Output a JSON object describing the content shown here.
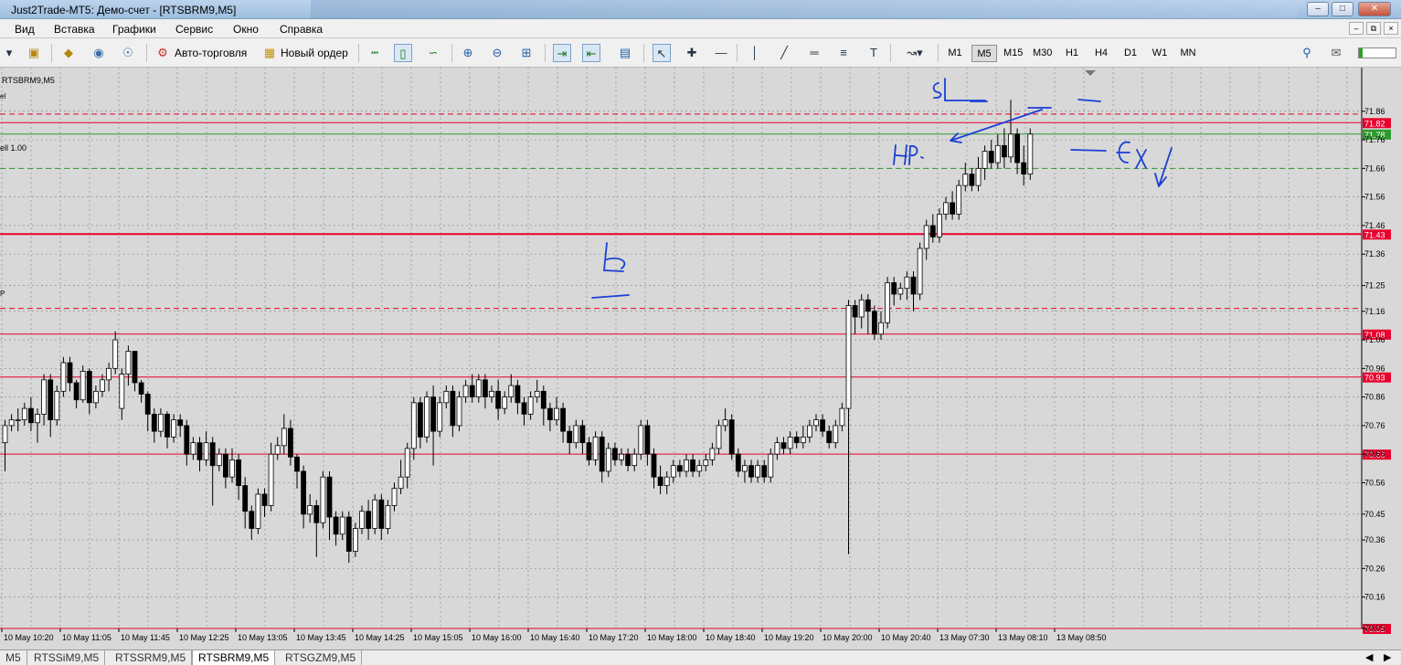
{
  "window": {
    "title": "Just2Trade-MT5: Демо-счет - [RTSBRM9,M5]"
  },
  "menu": [
    "Вид",
    "Вставка",
    "Графики",
    "Сервис",
    "Окно",
    "Справка"
  ],
  "toolbar": {
    "autotrade_label": "Авто-торговля",
    "new_order_label": "Новый ордер",
    "timeframes": [
      "M1",
      "M5",
      "M15",
      "M30",
      "H1",
      "H4",
      "D1",
      "W1",
      "MN"
    ],
    "active_timeframe": "M5"
  },
  "chart": {
    "symbol_label": "RTSBRM9,M5",
    "sell_label": "ell 1.00",
    "line_label_top": "el",
    "line_label_tp": "P"
  },
  "tabs": [
    "M5",
    "RTSSiM9,M5",
    "RTSSRM9,M5",
    "RTSBRM9,M5",
    "RTSGZM9,M5"
  ],
  "active_tab": "RTSBRM9,M5",
  "chart_data": {
    "type": "candlestick",
    "y_range": [
      70.05,
      71.92
    ],
    "y_ticks": [
      "71.86",
      "71.76",
      "71.66",
      "71.56",
      "71.46",
      "71.36",
      "71.25",
      "71.16",
      "71.06",
      "70.96",
      "70.86",
      "70.76",
      "70.66",
      "70.56",
      "70.45",
      "70.36",
      "70.26",
      "70.16",
      "70.05"
    ],
    "x_ticks": [
      "10 May 10:20",
      "10 May 11:05",
      "10 May 11:45",
      "10 May 12:25",
      "10 May 13:05",
      "10 May 13:45",
      "10 May 14:25",
      "10 May 15:05",
      "10 May 16:00",
      "10 May 16:40",
      "10 May 17:20",
      "10 May 18:00",
      "10 May 18:40",
      "10 May 19:20",
      "10 May 20:00",
      "10 May 20:40",
      "13 May 07:30",
      "13 May 08:10",
      "13 May 08:50"
    ],
    "horizontal_lines": [
      {
        "price": 71.82,
        "label": "71.82",
        "color": "#e8002d",
        "style": "solid"
      },
      {
        "price": 71.78,
        "label": "71.78",
        "color": "#2f9a2f",
        "style": "solid"
      },
      {
        "price": 71.43,
        "label": "71.43",
        "color": "#e8002d",
        "style": "solid"
      },
      {
        "price": 71.08,
        "label": "71.08",
        "color": "#e8002d",
        "style": "solid"
      },
      {
        "price": 70.93,
        "label": "70.93",
        "color": "#e8002d",
        "style": "solid"
      },
      {
        "price": 70.66,
        "label": "70.66",
        "color": "#e8002d",
        "style": "solid"
      },
      {
        "price": 70.05,
        "label": "70.05",
        "color": "#e8002d",
        "style": "solid"
      },
      {
        "price": 71.85,
        "label": "",
        "color": "#e8002d",
        "style": "dashed"
      },
      {
        "price": 71.66,
        "label": "",
        "color": "#2f9a2f",
        "style": "dashed"
      },
      {
        "price": 71.17,
        "label": "",
        "color": "#e8002d",
        "style": "dashed"
      }
    ],
    "candles": [
      [
        70.7,
        70.76,
        70.6,
        70.78
      ],
      [
        70.76,
        70.78,
        70.74,
        70.8
      ],
      [
        70.78,
        70.78,
        70.74,
        70.82
      ],
      [
        70.78,
        70.82,
        70.76,
        70.84
      ],
      [
        70.82,
        70.77,
        70.74,
        70.86
      ],
      [
        70.77,
        70.8,
        70.7,
        70.82
      ],
      [
        70.8,
        70.92,
        70.76,
        70.94
      ],
      [
        70.92,
        70.78,
        70.72,
        70.94
      ],
      [
        70.78,
        70.88,
        70.76,
        70.9
      ],
      [
        70.88,
        70.98,
        70.86,
        71.0
      ],
      [
        70.98,
        70.91,
        70.88,
        71.0
      ],
      [
        70.91,
        70.85,
        70.82,
        70.92
      ],
      [
        70.85,
        70.95,
        70.84,
        70.97
      ],
      [
        70.95,
        70.84,
        70.8,
        70.96
      ],
      [
        70.84,
        70.88,
        70.82,
        70.9
      ],
      [
        70.88,
        70.92,
        70.86,
        70.94
      ],
      [
        70.92,
        70.96,
        70.88,
        70.98
      ],
      [
        70.96,
        71.06,
        70.94,
        71.09
      ],
      [
        70.82,
        70.94,
        70.78,
        70.96
      ],
      [
        70.94,
        71.02,
        70.9,
        71.04
      ],
      [
        71.02,
        70.91,
        70.88,
        71.02
      ],
      [
        70.91,
        70.87,
        70.84,
        70.92
      ],
      [
        70.87,
        70.8,
        70.74,
        70.88
      ],
      [
        70.8,
        70.74,
        70.7,
        70.82
      ],
      [
        70.74,
        70.8,
        70.72,
        70.82
      ],
      [
        70.8,
        70.72,
        70.68,
        70.81
      ],
      [
        70.72,
        70.78,
        70.7,
        70.8
      ],
      [
        70.78,
        70.76,
        70.72,
        70.8
      ],
      [
        70.76,
        70.66,
        70.62,
        70.78
      ],
      [
        70.66,
        70.7,
        70.64,
        70.72
      ],
      [
        70.7,
        70.64,
        70.6,
        70.72
      ],
      [
        70.64,
        70.7,
        70.62,
        70.74
      ],
      [
        70.7,
        70.62,
        70.48,
        70.72
      ],
      [
        70.62,
        70.66,
        70.6,
        70.68
      ],
      [
        70.66,
        70.58,
        70.54,
        70.68
      ],
      [
        70.58,
        70.64,
        70.56,
        70.68
      ],
      [
        70.64,
        70.55,
        70.5,
        70.66
      ],
      [
        70.55,
        70.46,
        70.4,
        70.58
      ],
      [
        70.46,
        70.4,
        70.36,
        70.48
      ],
      [
        70.4,
        70.52,
        70.38,
        70.54
      ],
      [
        70.52,
        70.48,
        70.44,
        70.54
      ],
      [
        70.48,
        70.66,
        70.46,
        70.7
      ],
      [
        70.66,
        70.69,
        70.64,
        70.72
      ],
      [
        70.69,
        70.75,
        70.66,
        70.8
      ],
      [
        70.75,
        70.65,
        70.62,
        70.78
      ],
      [
        70.65,
        70.6,
        70.54,
        70.66
      ],
      [
        70.6,
        70.45,
        70.4,
        70.62
      ],
      [
        70.45,
        70.48,
        70.42,
        70.52
      ],
      [
        70.48,
        70.42,
        70.3,
        70.5
      ],
      [
        70.42,
        70.58,
        70.4,
        70.6
      ],
      [
        70.58,
        70.44,
        70.36,
        70.6
      ],
      [
        70.44,
        70.38,
        70.34,
        70.46
      ],
      [
        70.38,
        70.44,
        70.36,
        70.46
      ],
      [
        70.44,
        70.32,
        70.28,
        70.46
      ],
      [
        70.32,
        70.4,
        70.3,
        70.42
      ],
      [
        70.4,
        70.46,
        70.38,
        70.48
      ],
      [
        70.46,
        70.4,
        70.36,
        70.5
      ],
      [
        70.4,
        70.5,
        70.38,
        70.52
      ],
      [
        70.5,
        70.4,
        70.36,
        70.52
      ],
      [
        70.4,
        70.48,
        70.38,
        70.5
      ],
      [
        70.48,
        70.54,
        70.46,
        70.56
      ],
      [
        70.54,
        70.58,
        70.52,
        70.64
      ],
      [
        70.58,
        70.68,
        70.54,
        70.7
      ],
      [
        70.68,
        70.84,
        70.64,
        70.86
      ],
      [
        70.84,
        70.72,
        70.68,
        70.86
      ],
      [
        70.72,
        70.86,
        70.7,
        70.88
      ],
      [
        70.86,
        70.74,
        70.62,
        70.9
      ],
      [
        70.74,
        70.84,
        70.72,
        70.86
      ],
      [
        70.84,
        70.88,
        70.82,
        70.9
      ],
      [
        70.88,
        70.76,
        70.72,
        70.9
      ],
      [
        70.76,
        70.86,
        70.74,
        70.88
      ],
      [
        70.86,
        70.9,
        70.84,
        70.92
      ],
      [
        70.9,
        70.86,
        70.84,
        70.94
      ],
      [
        70.86,
        70.92,
        70.84,
        70.94
      ],
      [
        70.92,
        70.86,
        70.82,
        70.94
      ],
      [
        70.86,
        70.88,
        70.84,
        70.9
      ],
      [
        70.88,
        70.82,
        70.78,
        70.92
      ],
      [
        70.82,
        70.86,
        70.8,
        70.88
      ],
      [
        70.86,
        70.9,
        70.84,
        70.94
      ],
      [
        70.9,
        70.84,
        70.8,
        70.92
      ],
      [
        70.84,
        70.8,
        70.76,
        70.86
      ],
      [
        70.8,
        70.86,
        70.78,
        70.88
      ],
      [
        70.86,
        70.88,
        70.84,
        70.92
      ],
      [
        70.88,
        70.82,
        70.76,
        70.9
      ],
      [
        70.82,
        70.78,
        70.74,
        70.84
      ],
      [
        70.78,
        70.82,
        70.76,
        70.86
      ],
      [
        70.82,
        70.74,
        70.7,
        70.84
      ],
      [
        70.74,
        70.7,
        70.66,
        70.76
      ],
      [
        70.7,
        70.76,
        70.68,
        70.78
      ],
      [
        70.76,
        70.7,
        70.66,
        70.78
      ],
      [
        70.7,
        70.64,
        70.62,
        70.72
      ],
      [
        70.64,
        70.72,
        70.62,
        70.74
      ],
      [
        70.72,
        70.6,
        70.56,
        70.74
      ],
      [
        70.6,
        70.68,
        70.58,
        70.7
      ],
      [
        70.68,
        70.64,
        70.62,
        70.7
      ],
      [
        70.64,
        70.66,
        70.62,
        70.68
      ],
      [
        70.66,
        70.62,
        70.6,
        70.68
      ],
      [
        70.62,
        70.66,
        70.6,
        70.68
      ],
      [
        70.66,
        70.76,
        70.64,
        70.78
      ],
      [
        70.76,
        70.66,
        70.62,
        70.78
      ],
      [
        70.66,
        70.58,
        70.54,
        70.68
      ],
      [
        70.58,
        70.55,
        70.52,
        70.62
      ],
      [
        70.55,
        70.58,
        70.52,
        70.6
      ],
      [
        70.58,
        70.62,
        70.56,
        70.64
      ],
      [
        70.62,
        70.6,
        70.58,
        70.64
      ],
      [
        70.6,
        70.64,
        70.58,
        70.66
      ],
      [
        70.64,
        70.6,
        70.58,
        70.66
      ],
      [
        70.6,
        70.62,
        70.58,
        70.64
      ],
      [
        70.62,
        70.64,
        70.6,
        70.66
      ],
      [
        70.64,
        70.68,
        70.62,
        70.7
      ],
      [
        70.68,
        70.76,
        70.66,
        70.78
      ],
      [
        70.76,
        70.78,
        70.74,
        70.82
      ],
      [
        70.78,
        70.66,
        70.64,
        70.8
      ],
      [
        70.66,
        70.6,
        70.58,
        70.68
      ],
      [
        70.6,
        70.62,
        70.56,
        70.64
      ],
      [
        70.62,
        70.58,
        70.56,
        70.64
      ],
      [
        70.58,
        70.62,
        70.56,
        70.64
      ],
      [
        70.62,
        70.58,
        70.56,
        70.64
      ],
      [
        70.58,
        70.66,
        70.56,
        70.68
      ],
      [
        70.66,
        70.7,
        70.64,
        70.72
      ],
      [
        70.7,
        70.68,
        70.66,
        70.72
      ],
      [
        70.68,
        70.72,
        70.66,
        70.74
      ],
      [
        70.72,
        70.7,
        70.68,
        70.74
      ],
      [
        70.7,
        70.72,
        70.68,
        70.76
      ],
      [
        70.72,
        70.76,
        70.7,
        70.78
      ],
      [
        70.76,
        70.78,
        70.74,
        70.8
      ],
      [
        70.78,
        70.74,
        70.72,
        70.8
      ],
      [
        70.74,
        70.7,
        70.68,
        70.76
      ],
      [
        70.7,
        70.76,
        70.68,
        70.78
      ],
      [
        70.76,
        70.82,
        70.74,
        70.84
      ],
      [
        70.82,
        71.18,
        70.31,
        71.2
      ],
      [
        71.18,
        71.14,
        71.08,
        71.2
      ],
      [
        71.14,
        71.2,
        71.1,
        71.22
      ],
      [
        71.2,
        71.16,
        71.08,
        71.22
      ],
      [
        71.16,
        71.08,
        71.06,
        71.18
      ],
      [
        71.08,
        71.12,
        71.06,
        71.16
      ],
      [
        71.12,
        71.26,
        71.1,
        71.28
      ],
      [
        71.26,
        71.22,
        71.18,
        71.28
      ],
      [
        71.22,
        71.24,
        71.2,
        71.26
      ],
      [
        71.24,
        71.28,
        71.2,
        71.3
      ],
      [
        71.28,
        71.22,
        71.16,
        71.3
      ],
      [
        71.22,
        71.38,
        71.2,
        71.4
      ],
      [
        71.38,
        71.46,
        71.34,
        71.48
      ],
      [
        71.46,
        71.42,
        71.4,
        71.5
      ],
      [
        71.42,
        71.5,
        71.4,
        71.52
      ],
      [
        71.5,
        71.54,
        71.48,
        71.56
      ],
      [
        71.54,
        71.5,
        71.48,
        71.58
      ],
      [
        71.5,
        71.6,
        71.48,
        71.62
      ],
      [
        71.6,
        71.64,
        71.58,
        71.68
      ],
      [
        71.64,
        71.6,
        71.58,
        71.66
      ],
      [
        71.6,
        71.66,
        71.58,
        71.7
      ],
      [
        71.66,
        71.72,
        71.62,
        71.74
      ],
      [
        71.72,
        71.68,
        71.66,
        71.76
      ],
      [
        71.68,
        71.74,
        71.66,
        71.78
      ],
      [
        71.74,
        71.7,
        71.66,
        71.8
      ],
      [
        71.7,
        71.78,
        71.68,
        71.9
      ],
      [
        71.78,
        71.68,
        71.64,
        71.8
      ],
      [
        71.68,
        71.64,
        71.6,
        71.74
      ],
      [
        71.64,
        71.78,
        71.62,
        71.8
      ]
    ]
  }
}
